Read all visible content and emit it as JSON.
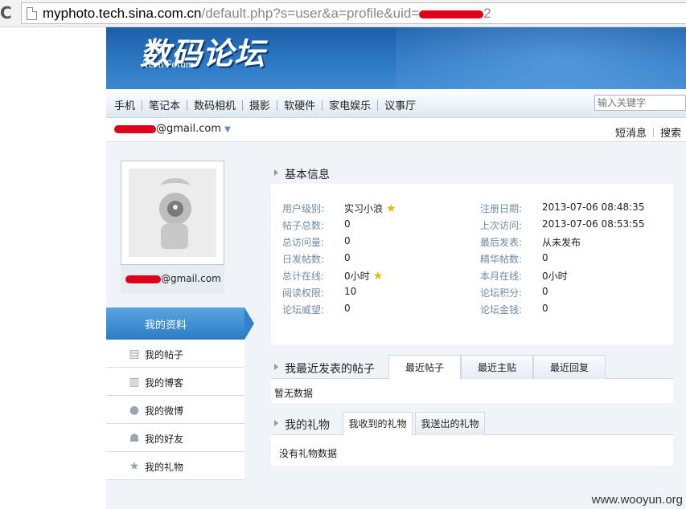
{
  "browser": {
    "url_host": "myphoto.tech.sina.com.cn",
    "url_path": "/default.php?s=user&a=profile&uid=",
    "url_uid_tail": "2"
  },
  "banner": {
    "logo_cn": "数码论坛",
    "logo_en": "Tech Forum"
  },
  "nav": {
    "items": [
      "手机",
      "笔记本",
      "数码相机",
      "摄影",
      "软硬件",
      "家电娱乐",
      "议事厅"
    ],
    "search_placeholder": "输入关键字"
  },
  "userbar": {
    "email_suffix": "@gmail.com",
    "links": [
      "短消息",
      "搜索"
    ]
  },
  "sidebar": {
    "avatar_email_suffix": "@gmail.com",
    "active_menu": "我的资料",
    "menu": [
      {
        "label": "我的帖子",
        "icon": "posts-icon"
      },
      {
        "label": "我的博客",
        "icon": "blog-icon"
      },
      {
        "label": "我的微博",
        "icon": "weibo-icon"
      },
      {
        "label": "我的好友",
        "icon": "friends-icon"
      },
      {
        "label": "我的礼物",
        "icon": "gift-star-icon"
      }
    ]
  },
  "basic_info": {
    "title": "基本信息",
    "left": [
      {
        "k": "用户级别:",
        "v": "实习小浪",
        "star": true
      },
      {
        "k": "帖子总数:",
        "v": "0"
      },
      {
        "k": "总访问量:",
        "v": "0"
      },
      {
        "k": "日发帖数:",
        "v": "0"
      },
      {
        "k": "总计在线:",
        "v": "0小时",
        "star": true
      },
      {
        "k": "阅读权限:",
        "v": "10"
      },
      {
        "k": "论坛威望:",
        "v": "0"
      }
    ],
    "right": [
      {
        "k": "注册日期:",
        "v": "2013-07-06 08:48:35"
      },
      {
        "k": "上次访问:",
        "v": "2013-07-06 08:53:55"
      },
      {
        "k": "最后发表:",
        "v": "从未发布"
      },
      {
        "k": "精华帖数:",
        "v": "0"
      },
      {
        "k": "本月在线:",
        "v": "0小时"
      },
      {
        "k": "论坛积分:",
        "v": "0"
      },
      {
        "k": "论坛金钱:",
        "v": "0"
      }
    ]
  },
  "posts": {
    "title": "我最近发表的帖子",
    "tabs": [
      "最近帖子",
      "最近主贴",
      "最近回复"
    ],
    "empty": "暂无数据"
  },
  "gifts": {
    "title": "我的礼物",
    "tabs": [
      "我收到的礼物",
      "我送出的礼物"
    ],
    "empty": "没有礼物数据"
  },
  "watermark": "www.wooyun.org"
}
